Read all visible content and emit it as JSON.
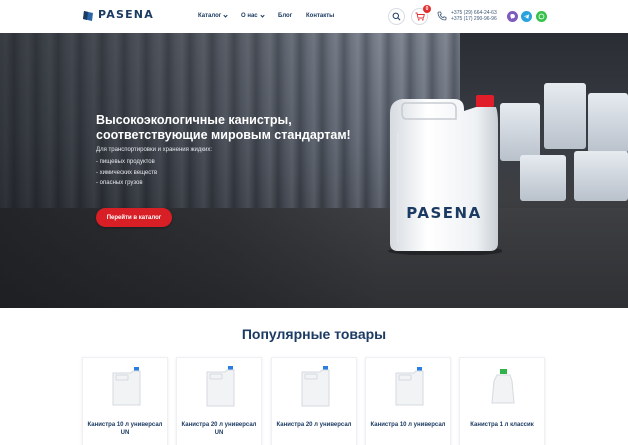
{
  "header": {
    "logo_text": "PASENA",
    "nav": [
      {
        "label": "Каталог"
      },
      {
        "label": "О нас"
      },
      {
        "label": "Блог"
      },
      {
        "label": "Контакты"
      }
    ],
    "cart_count": "0",
    "phones": [
      "+375 (29) 664-24-63",
      "+375 (17) 290-96-96"
    ]
  },
  "hero": {
    "title": "Высокоэкологичные канистры, соответствующие мировым стандартам!",
    "subtitle": "Для транспортировки и хранения жидких:",
    "list": [
      "пищевых продуктов",
      "химических веществ",
      "опасных грузов"
    ],
    "cta_label": "Перейти в каталог",
    "product_brand": "PASENA"
  },
  "popular": {
    "title": "Популярные товары",
    "products": [
      {
        "name": "Канистра 10 л универсал UN",
        "cap": "#2a7de1"
      },
      {
        "name": "Канистра 20 л универсал UN",
        "cap": "#2a7de1"
      },
      {
        "name": "Канистра 20 л универсал",
        "cap": "#2a7de1"
      },
      {
        "name": "Канистра 10 л универсал",
        "cap": "#2a7de1"
      },
      {
        "name": "Канистра 1 л классик",
        "cap": "#2fb34a"
      }
    ]
  },
  "colors": {
    "brand": "#1c3b63",
    "accent": "#d91f26",
    "viber": "#7d5bbe",
    "telegram": "#2aa3dc",
    "whatsapp": "#36c24a"
  },
  "icons": [
    "logo-icon",
    "search-icon",
    "cart-icon",
    "phone-icon",
    "viber-icon",
    "telegram-icon",
    "whatsapp-icon"
  ]
}
